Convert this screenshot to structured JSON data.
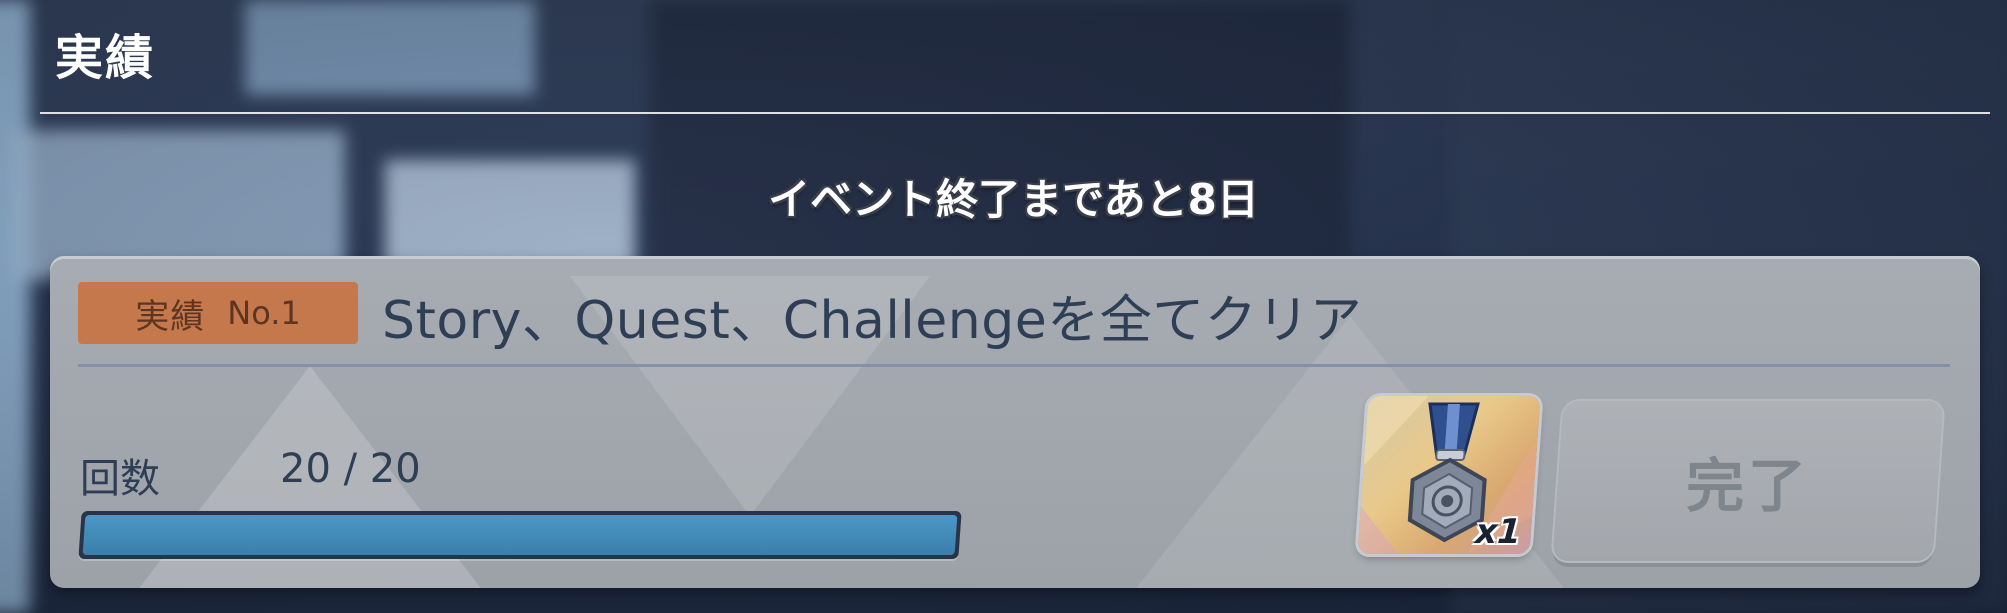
{
  "header": {
    "title": "実績",
    "event_remaining": "イベント終了まであと8日"
  },
  "achievement": {
    "badge_label": "実績",
    "badge_number": "No.1",
    "title": "Story、Quest、Challengeを全てクリア",
    "count_label": "回数",
    "count_value": "20 / 20",
    "progress_fraction": 1.0,
    "reward": {
      "icon": "medal-icon",
      "quantity": "x1"
    },
    "complete_label": "完了"
  },
  "colors": {
    "badge": "#c6784d",
    "progress_fill": "#3a7fac",
    "title_text": "#2d3e55"
  }
}
